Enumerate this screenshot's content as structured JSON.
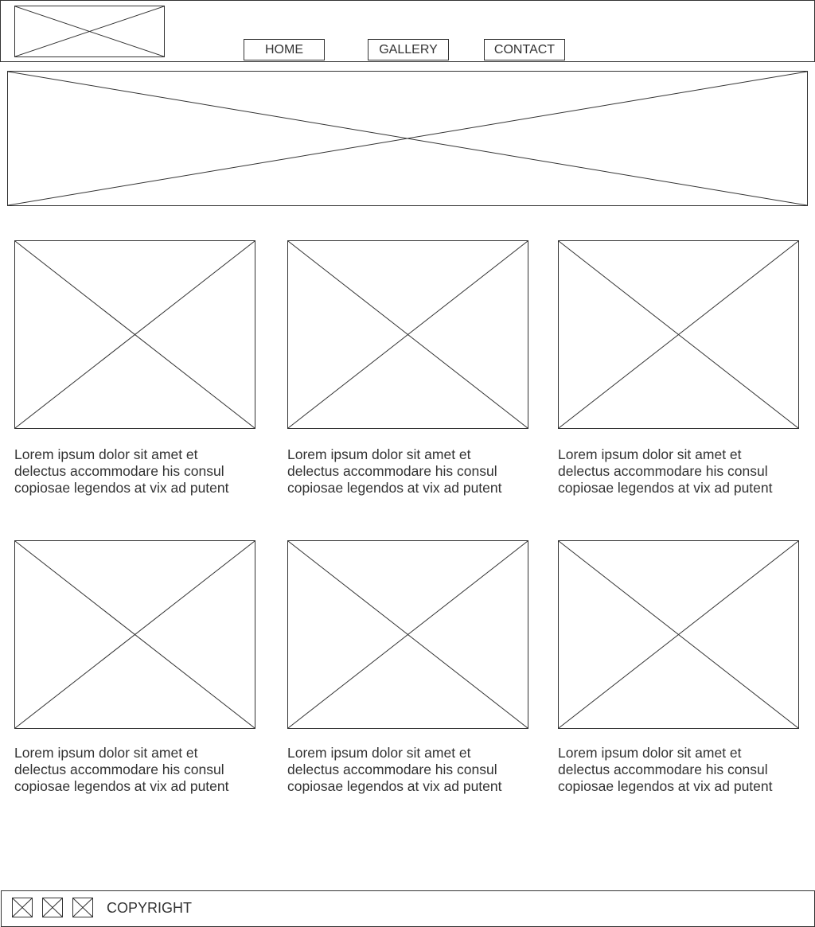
{
  "header": {
    "logo_icon": "image-placeholder-icon",
    "nav": [
      {
        "label": "HOME"
      },
      {
        "label": "GALLERY"
      },
      {
        "label": "CONTACT"
      }
    ]
  },
  "hero": {
    "icon": "image-placeholder-icon"
  },
  "gallery": {
    "items": [
      {
        "icon": "image-placeholder-icon",
        "caption": "Lorem ipsum dolor sit amet et\ndelectus accommodare his consul\ncopiosae legendos at vix ad putent"
      },
      {
        "icon": "image-placeholder-icon",
        "caption": "Lorem ipsum dolor sit amet et\ndelectus accommodare his consul\ncopiosae legendos at vix ad putent"
      },
      {
        "icon": "image-placeholder-icon",
        "caption": "Lorem ipsum dolor sit amet et\ndelectus accommodare his consul\ncopiosae legendos at vix ad putent"
      },
      {
        "icon": "image-placeholder-icon",
        "caption": "Lorem ipsum dolor sit amet et\ndelectus accommodare his consul\ncopiosae legendos at vix ad putent"
      },
      {
        "icon": "image-placeholder-icon",
        "caption": "Lorem ipsum dolor sit amet et\ndelectus accommodare his consul\ncopiosae legendos at vix ad putent"
      },
      {
        "icon": "image-placeholder-icon",
        "caption": "Lorem ipsum dolor sit amet et\ndelectus accommodare his consul\ncopiosae legendos at vix ad putent"
      }
    ]
  },
  "footer": {
    "social_icons": [
      "social-icon-1",
      "social-icon-2",
      "social-icon-3"
    ],
    "copyright": "COPYRIGHT"
  }
}
